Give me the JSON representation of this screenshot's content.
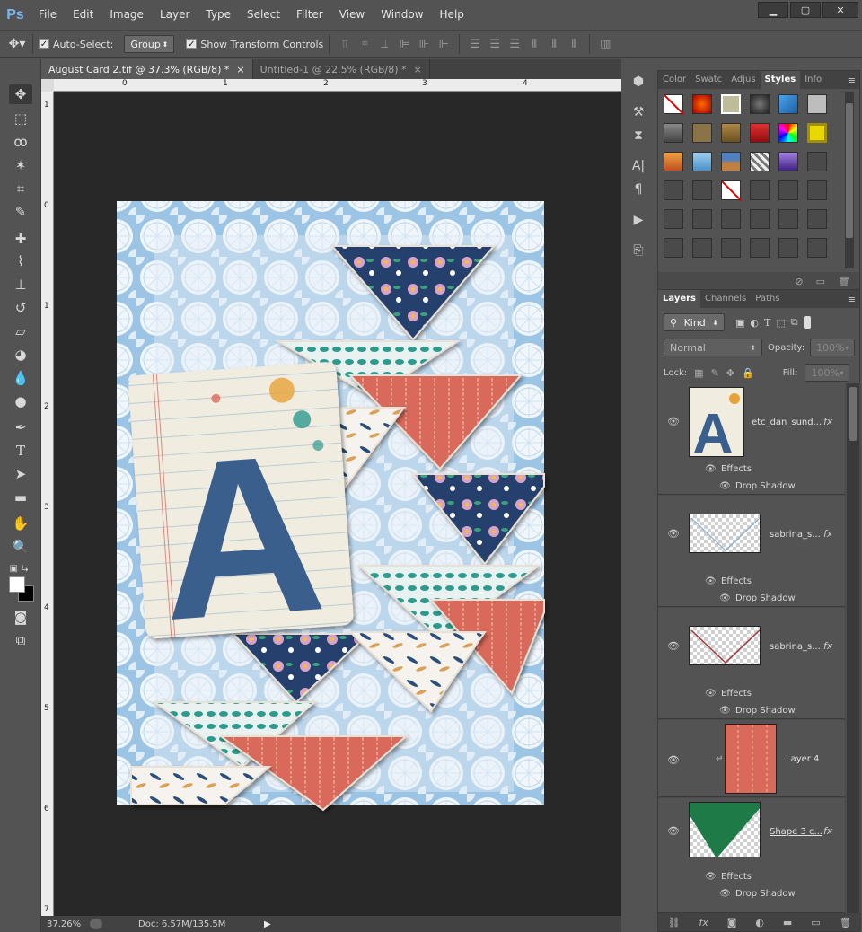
{
  "app": {
    "logo": "Ps"
  },
  "menu": [
    "File",
    "Edit",
    "Image",
    "Layer",
    "Type",
    "Select",
    "Filter",
    "View",
    "Window",
    "Help"
  ],
  "window_controls": [
    "▁",
    "▢",
    "✕"
  ],
  "options": {
    "auto_select_label": "Auto-Select:",
    "auto_select_value": "Group",
    "transform_label": "Show Transform Controls"
  },
  "tabs": [
    {
      "label": "August Card 2.tif @ 37.3% (RGB/8) *",
      "close": "×"
    },
    {
      "label": "Untitled-1 @ 22.5% (RGB/8) *",
      "close": "×"
    }
  ],
  "ruler_h": [
    "0",
    "1",
    "2",
    "3",
    "4"
  ],
  "ruler_v": [
    "1",
    "0",
    "1",
    "2",
    "3",
    "4",
    "5",
    "6",
    "7"
  ],
  "status": {
    "zoom": "37.26%",
    "doc": "Doc: 6.57M/135.5M"
  },
  "styles_tabs": [
    "Color",
    "Swatc",
    "Adjus",
    "Styles",
    "Info"
  ],
  "layers_tabs": [
    "Layers",
    "Channels",
    "Paths"
  ],
  "layers_controls": {
    "kind": "Kind",
    "blend": "Normal",
    "opacity_label": "Opacity:",
    "opacity_value": "100%",
    "lock_label": "Lock:",
    "fill_label": "Fill:",
    "fill_value": "100%"
  },
  "layers": [
    {
      "name": "etc_dan_sund...",
      "fx": "fx",
      "effects": "Effects",
      "shadow": "Drop Shadow"
    },
    {
      "name": "sabrina_s...",
      "fx": "fx",
      "effects": "Effects",
      "shadow": "Drop Shadow"
    },
    {
      "name": "sabrina_s...",
      "fx": "fx",
      "effects": "Effects",
      "shadow": "Drop Shadow"
    },
    {
      "name": "Layer 4"
    },
    {
      "name": "Shape 3 c...",
      "fx": "fx",
      "effects": "Effects",
      "shadow": "Drop Shadow"
    }
  ],
  "card": {
    "letter": "A"
  },
  "colors": {
    "accent_blue": "#3a5f8c",
    "coral": "#d9695a",
    "teal": "#2e9a8e",
    "navy": "#27406e",
    "sky": "#9cc4e4",
    "green_shape": "#1e7a47"
  }
}
